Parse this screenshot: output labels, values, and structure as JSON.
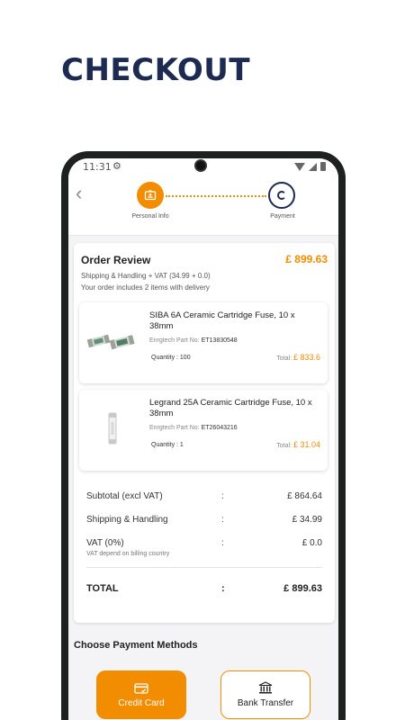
{
  "hero": {
    "title": "CHECKOUT"
  },
  "status": {
    "time": "11:31"
  },
  "stepper": {
    "steps": [
      {
        "label": "Personal Info"
      },
      {
        "label": "Payment"
      }
    ]
  },
  "review": {
    "title": "Order Review",
    "total": "£ 899.63",
    "shipping_note": "Shipping & Handling + VAT (34.99 + 0.0)",
    "items_note": "Your order includes 2 items with delivery"
  },
  "items": [
    {
      "name": "SIBA 6A Ceramic Cartridge Fuse, 10 x 38mm",
      "part_label": "Enrgtech Part No:",
      "part_no": "ET13830548",
      "quantity": "Quantity : 100",
      "total_label": "Total:",
      "total": "£ 833.6"
    },
    {
      "name": "Legrand 25A Ceramic Cartridge Fuse, 10 x 38mm",
      "part_label": "Enrgtech Part No:",
      "part_no": "ET26043216",
      "quantity": "Quantity : 1",
      "total_label": "Total:",
      "total": "£ 31.04"
    }
  ],
  "summary": {
    "colon": ":",
    "subtotal_label": "Subtotal (excl VAT)",
    "subtotal": "£ 864.64",
    "shipping_label": "Shipping & Handling",
    "shipping": "£ 34.99",
    "vat_label": "VAT (0%)",
    "vat": "£ 0.0",
    "vat_note": "VAT depend on billing country",
    "total_label": "TOTAL",
    "total": "£ 899.63"
  },
  "payment": {
    "title": "Choose Payment Methods",
    "methods": [
      {
        "label": "Credit Card",
        "icon": "credit-card-icon",
        "selected": true
      },
      {
        "label": "Bank Transfer",
        "icon": "bank-icon",
        "selected": false
      }
    ]
  },
  "colors": {
    "accent": "#f28c00",
    "navy": "#1d2b52"
  }
}
